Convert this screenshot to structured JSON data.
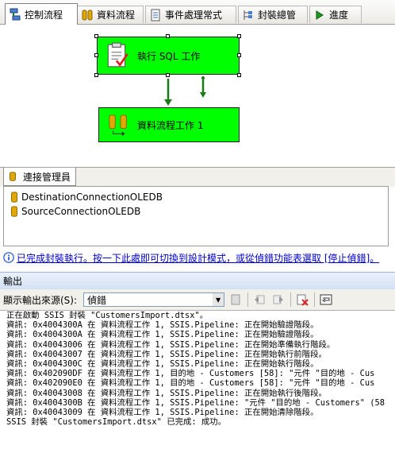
{
  "tabs": [
    {
      "label": "控制流程",
      "icon": "control-flow-icon",
      "active": true
    },
    {
      "label": "資料流程",
      "icon": "data-flow-icon",
      "active": false
    },
    {
      "label": "事件處理常式",
      "icon": "event-handlers-icon",
      "active": false
    },
    {
      "label": "封裝總管",
      "icon": "package-explorer-icon",
      "active": false
    },
    {
      "label": "進度",
      "icon": "progress-icon",
      "active": false
    }
  ],
  "tasks": [
    {
      "label": "執行 SQL 工作",
      "icon": "execute-sql-task-icon",
      "status": "success"
    },
    {
      "label": "資料流程工作 1",
      "icon": "data-flow-task-icon",
      "status": "success"
    }
  ],
  "connection_manager": {
    "tab_label": "連接管理員",
    "items": [
      "DestinationConnectionOLEDB",
      "SourceConnectionOLEDB"
    ]
  },
  "status_bar": {
    "text": "已完成封裝執行。按一下此處即可切換到設計模式，或從偵錯功能表選取 [停止偵錯]。"
  },
  "output": {
    "title": "輸出",
    "source_label": "顯示輸出來源(S):",
    "source_value": "偵錯",
    "lines": [
      "正在啟動 SSIS 封裝 \"CustomersImport.dtsx\"。",
      "資訊: 0x4004300A 在 資料流程工作 1, SSIS.Pipeline: 正在開始驗證階段。",
      "資訊: 0x4004300A 在 資料流程工作 1, SSIS.Pipeline: 正在開始驗證階段。",
      "資訊: 0x40043006 在 資料流程工作 1, SSIS.Pipeline: 正在開始準備執行階段。",
      "資訊: 0x40043007 在 資料流程工作 1, SSIS.Pipeline: 正在開始執行前階段。",
      "資訊: 0x4004300C 在 資料流程工作 1, SSIS.Pipeline: 正在開始執行階段。",
      "資訊: 0x402090DF 在 資料流程工作 1, 目的地 - Customers [58]: \"元件 \"目的地 - Cus",
      "資訊: 0x402090E0 在 資料流程工作 1, 目的地 - Customers [58]: \"元件 \"目的地 - Cus",
      "資訊: 0x40043008 在 資料流程工作 1, SSIS.Pipeline: 正在開始執行後階段。",
      "資訊: 0x4004300B 在 資料流程工作 1, SSIS.Pipeline: \"元件 \"目的地 - Customers\" (58",
      "資訊: 0x40043009 在 資料流程工作 1, SSIS.Pipeline: 正在開始清除階段。",
      "SSIS 封裝 \"CustomersImport.dtsx\" 已完成: 成功。"
    ]
  }
}
